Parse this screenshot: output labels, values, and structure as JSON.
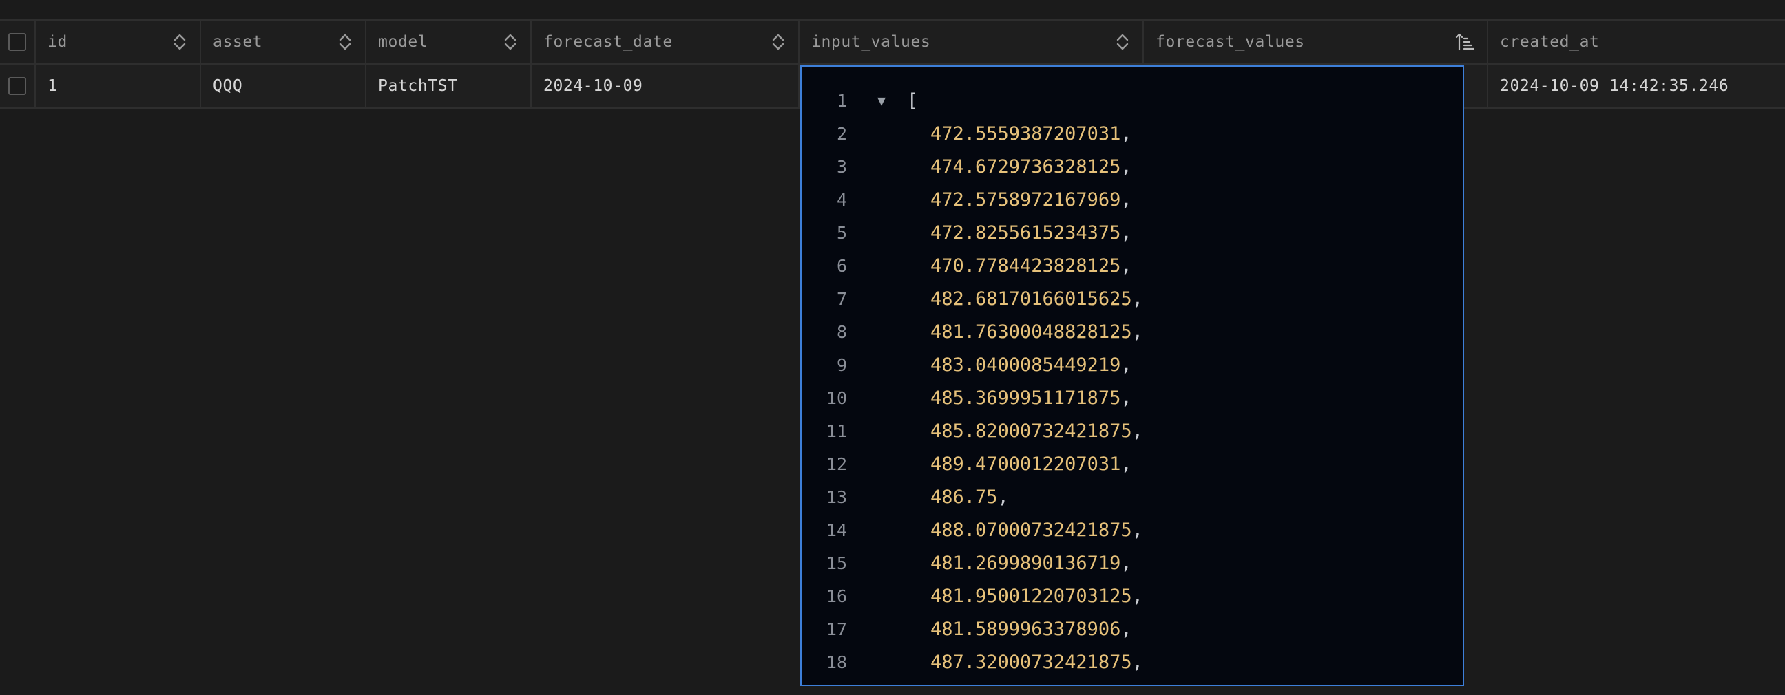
{
  "table": {
    "columns": [
      {
        "key": "id",
        "label": "id"
      },
      {
        "key": "asset",
        "label": "asset"
      },
      {
        "key": "model",
        "label": "model"
      },
      {
        "key": "forecast_date",
        "label": "forecast_date"
      },
      {
        "key": "input_values",
        "label": "input_values"
      },
      {
        "key": "forecast_values",
        "label": "forecast_values"
      },
      {
        "key": "created_at",
        "label": "created_at"
      }
    ],
    "rows": [
      {
        "id": "1",
        "asset": "QQQ",
        "model": "PatchTST",
        "forecast_date": "2024-10-09",
        "created_at": "2024-10-09 14:42:35.246"
      }
    ]
  },
  "editor": {
    "fold_glyph": "▼",
    "open_bracket": "[",
    "values": [
      "472.5559387207031",
      "474.6729736328125",
      "472.5758972167969",
      "472.8255615234375",
      "470.7784423828125",
      "482.68170166015625",
      "481.76300048828125",
      "483.0400085449219",
      "485.3699951171875",
      "485.82000732421875",
      "489.4700012207031",
      "486.75",
      "488.07000732421875",
      "481.2699890136719",
      "481.95001220703125",
      "481.5899963378906",
      "487.32000732421875"
    ]
  },
  "icons": {
    "sort": "sort-updown-icon",
    "sort_active": "sort-ascending-icon",
    "fold": "fold-triangle-icon"
  },
  "colors": {
    "background": "#1b1b1b",
    "editor_background": "#04070f",
    "editor_border": "#3d7fd9",
    "number": "#e6c17a"
  }
}
